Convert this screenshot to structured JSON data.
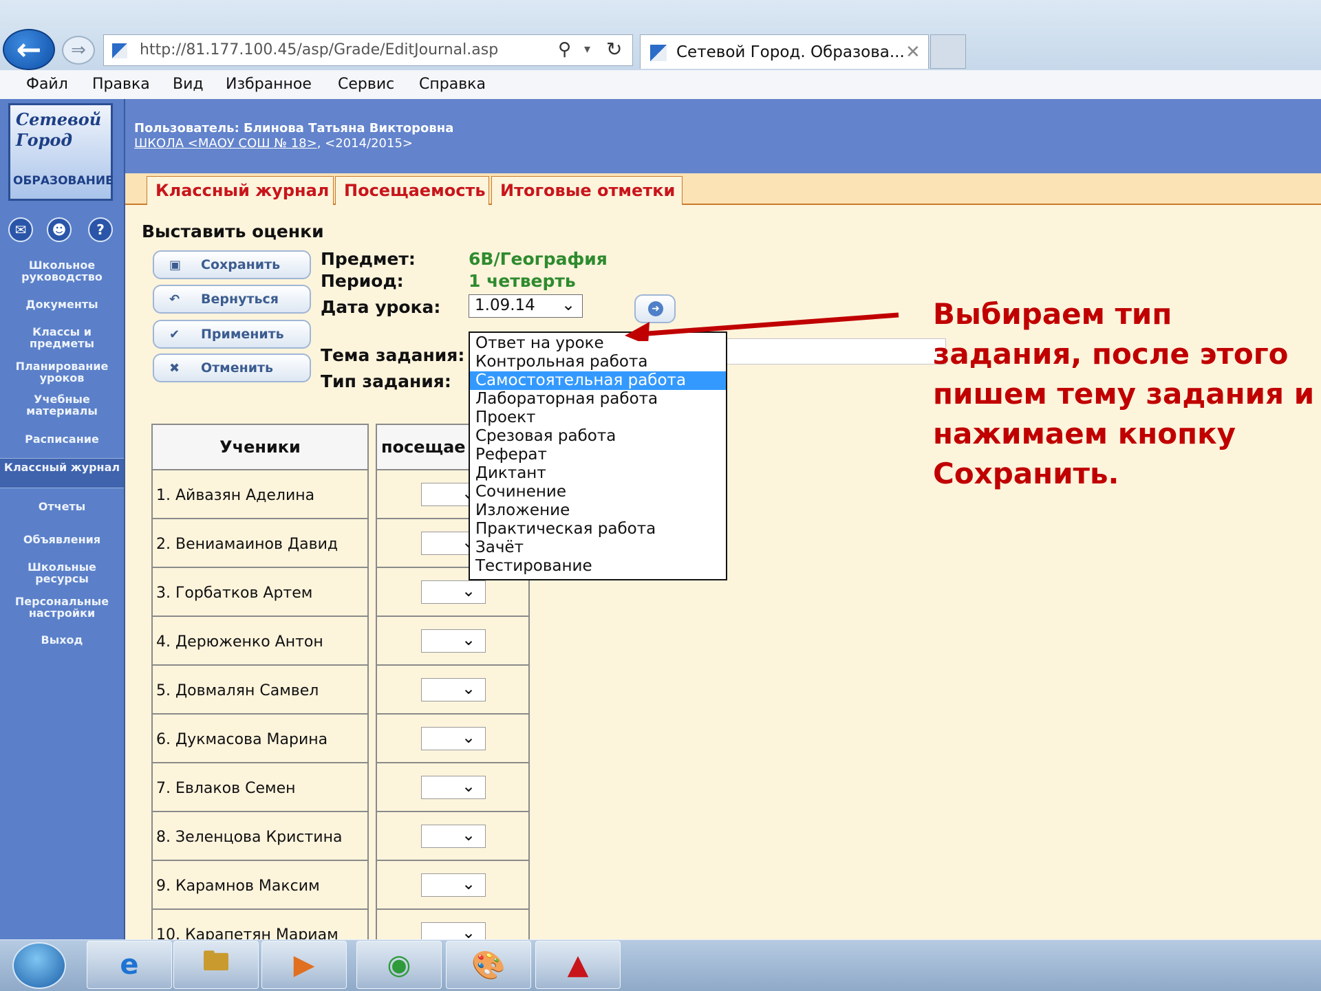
{
  "browser": {
    "address": "http://81.177.100.45/asp/Grade/EditJournal.asp",
    "tab_title": "Сетевой Город. Образова...",
    "menu": [
      "Файл",
      "Правка",
      "Вид",
      "Избранное",
      "Сервис",
      "Справка"
    ]
  },
  "logo": {
    "line1": "Сетевой",
    "line2": "Город",
    "line3": "ОБРАЗОВАНИЕ"
  },
  "header": {
    "user": "Пользователь: Блинова Татьяна Викторовна",
    "school_link": "ШКОЛА <МАОУ СОШ № 18>",
    "year": ",  <2014/2015>"
  },
  "sidebar": {
    "items": [
      {
        "label": "Школьное руководство"
      },
      {
        "label": "Документы"
      },
      {
        "label": "Классы и предметы"
      },
      {
        "label": "Планирование уроков"
      },
      {
        "label": "Учебные материалы"
      },
      {
        "label": "Расписание"
      },
      {
        "label": "Классный журнал",
        "active": true
      },
      {
        "label": "Отчеты"
      },
      {
        "label": "Объявления"
      },
      {
        "label": "Школьные ресурсы"
      },
      {
        "label": "Персональные настройки"
      },
      {
        "label": "Выход"
      }
    ]
  },
  "tabs": [
    "Классный журнал",
    "Посещаемость",
    "Итоговые отметки"
  ],
  "form": {
    "heading": "Выставить оценки",
    "buttons": [
      "Сохранить",
      "Вернуться",
      "Применить",
      "Отменить"
    ],
    "subject_label": "Предмет:",
    "subject_value": "6В/География",
    "period_label": "Период:",
    "period_value": "1 четверть",
    "date_label": "Дата урока:",
    "date_value": "1.09.14",
    "theme_label": "Тема задания:",
    "type_label": "Тип задания:"
  },
  "task_types": {
    "selected": "Самостоятельная работа",
    "options": [
      "Ответ на уроке",
      "Контрольная работа",
      "Самостоятельная работа",
      "Лабораторная работа",
      "Проект",
      "Срезовая работа",
      "Реферат",
      "Диктант",
      "Сочинение",
      "Изложение",
      "Практическая работа",
      "Зачёт",
      "Тестирование"
    ]
  },
  "table": {
    "headers": [
      "Ученики",
      "посещае"
    ],
    "students": [
      "1. Айвазян Аделина",
      "2. Вениамаинов Давид",
      "3. Горбатков Артем",
      "4. Дерюженко Антон",
      "5. Довмалян Самвел",
      "6. Дукмасова Марина",
      "7. Евлаков Семен",
      "8. Зеленцова Кристина",
      "9. Карамнов Максим",
      "10. Карапетян Мариам"
    ]
  },
  "annotation": "Выбираем тип задания, после этого пишем тему задания и нажимаем кнопку Сохранить.",
  "colors": {
    "accent_red": "#c00000",
    "sidebar_blue": "#5b80c9",
    "selected_option": "#3399ff"
  }
}
